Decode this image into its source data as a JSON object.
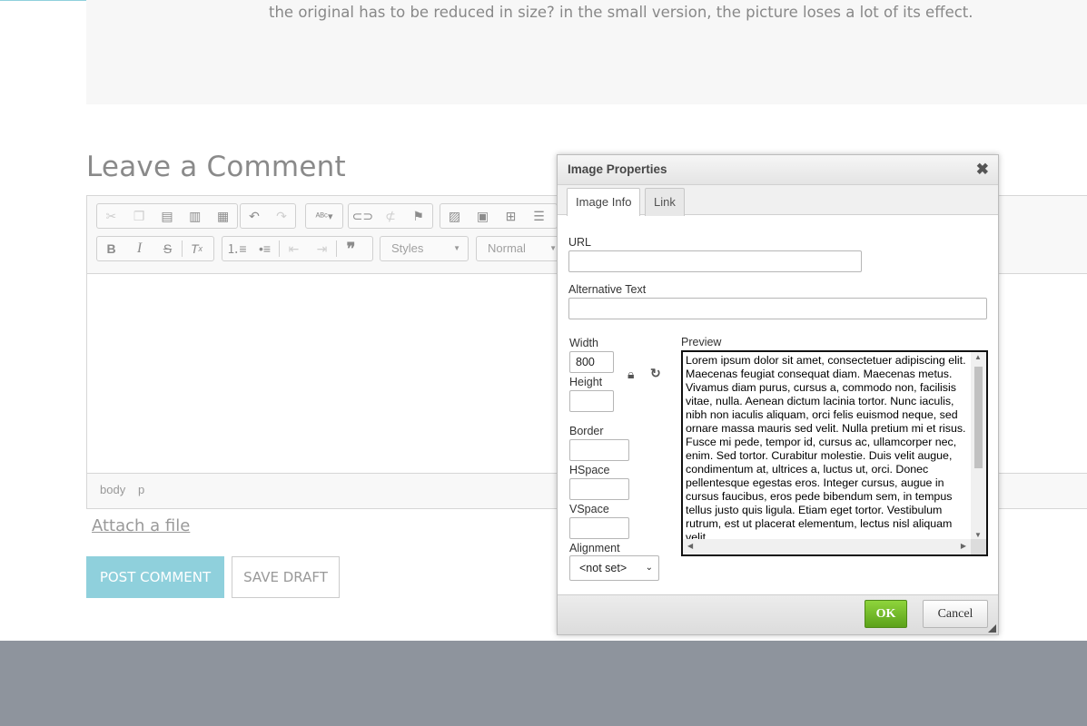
{
  "page": {
    "quote_text": "the original has to be reduced in size? in the small version, the picture loses a lot of its effect.",
    "heading": "Leave a Comment",
    "attach_label": "Attach a file",
    "post_label": "POST COMMENT",
    "draft_label": "SAVE DRAFT"
  },
  "editor": {
    "styles_label": "Styles",
    "format_label": "Normal",
    "path": [
      "body",
      "p"
    ]
  },
  "dialog": {
    "title": "Image Properties",
    "tabs": [
      {
        "label": "Image Info",
        "active": true
      },
      {
        "label": "Link",
        "active": false
      }
    ],
    "url_label": "URL",
    "url_value": "",
    "alt_label": "Alternative Text",
    "alt_value": "",
    "width_label": "Width",
    "width_value": "800",
    "height_label": "Height",
    "height_value": "",
    "border_label": "Border",
    "border_value": "",
    "hspace_label": "HSpace",
    "hspace_value": "",
    "vspace_label": "VSpace",
    "vspace_value": "",
    "alignment_label": "Alignment",
    "alignment_value": "<not set>",
    "preview_label": "Preview",
    "preview_text": "Lorem ipsum dolor sit amet, consectetuer adipiscing elit. Maecenas feugiat consequat diam. Maecenas metus. Vivamus diam purus, cursus a, commodo non, facilisis vitae, nulla. Aenean dictum lacinia tortor. Nunc iaculis, nibh non iaculis aliquam, orci felis euismod neque, sed ornare massa mauris sed velit. Nulla pretium mi et risus. Fusce mi pede, tempor id, cursus ac, ullamcorper nec, enim. Sed tortor. Curabitur molestie. Duis velit augue, condimentum at, ultrices a, luctus ut, orci. Donec pellentesque egestas eros. Integer cursus, augue in cursus faucibus, eros pede bibendum sem, in tempus tellus justo quis ligula. Etiam eget tortor. Vestibulum rutrum, est ut placerat elementum, lectus nisl aliquam velit",
    "ok_label": "OK",
    "cancel_label": "Cancel"
  },
  "colors": {
    "accent": "#8fd0dc",
    "ok_green": "#6cb52a",
    "footer": "#8e949d"
  }
}
